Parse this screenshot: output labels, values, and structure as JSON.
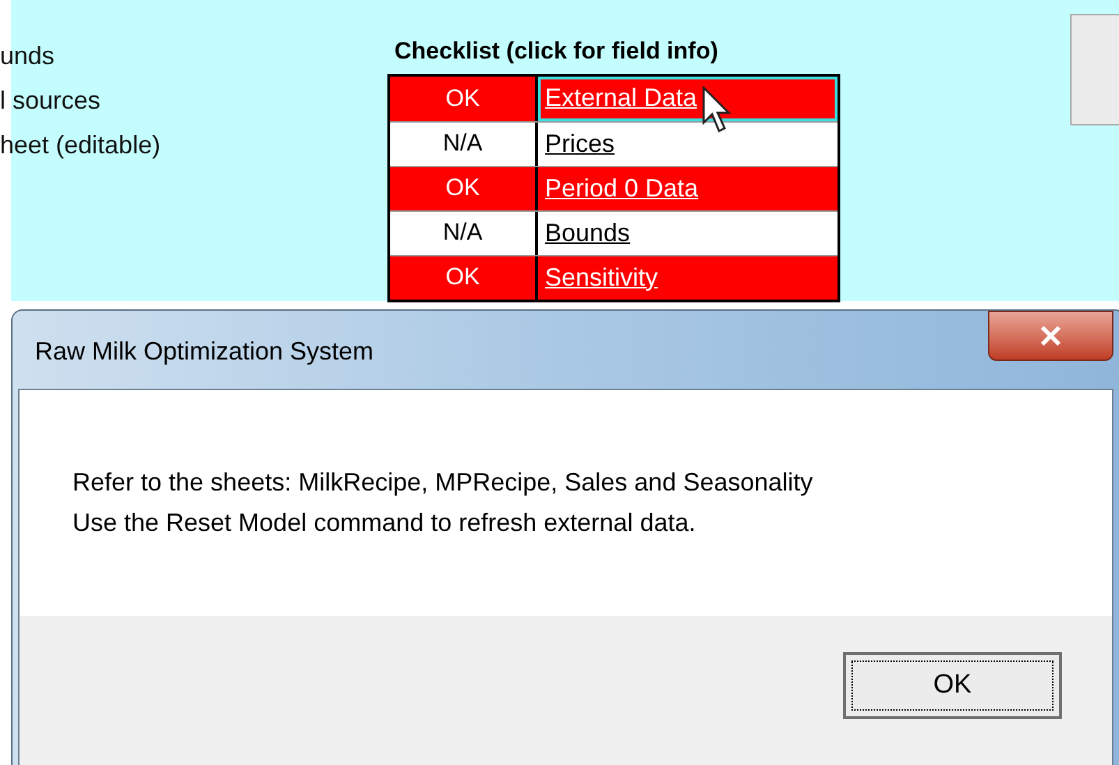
{
  "sheet": {
    "left_labels": [
      "unds",
      "l sources",
      "heet (editable)"
    ],
    "checklist": {
      "title": "Checklist (click for field info)",
      "rows": [
        {
          "status": "OK",
          "item": "External Data",
          "kind": "ok",
          "selected": true
        },
        {
          "status": "N/A",
          "item": "Prices",
          "kind": "na",
          "selected": false
        },
        {
          "status": "OK",
          "item": "Period 0 Data",
          "kind": "ok",
          "selected": false
        },
        {
          "status": "N/A",
          "item": "Bounds",
          "kind": "na",
          "selected": false
        },
        {
          "status": "OK",
          "item": "Sensitivity",
          "kind": "ok",
          "selected": false
        }
      ]
    }
  },
  "dialog": {
    "title": "Raw Milk Optimization System",
    "message": [
      "Refer to the sheets: MilkRecipe, MPRecipe, Sales and Seasonality",
      "Use the Reset Model command to refresh external data."
    ],
    "button": {
      "label": "OK",
      "focused": true
    }
  }
}
